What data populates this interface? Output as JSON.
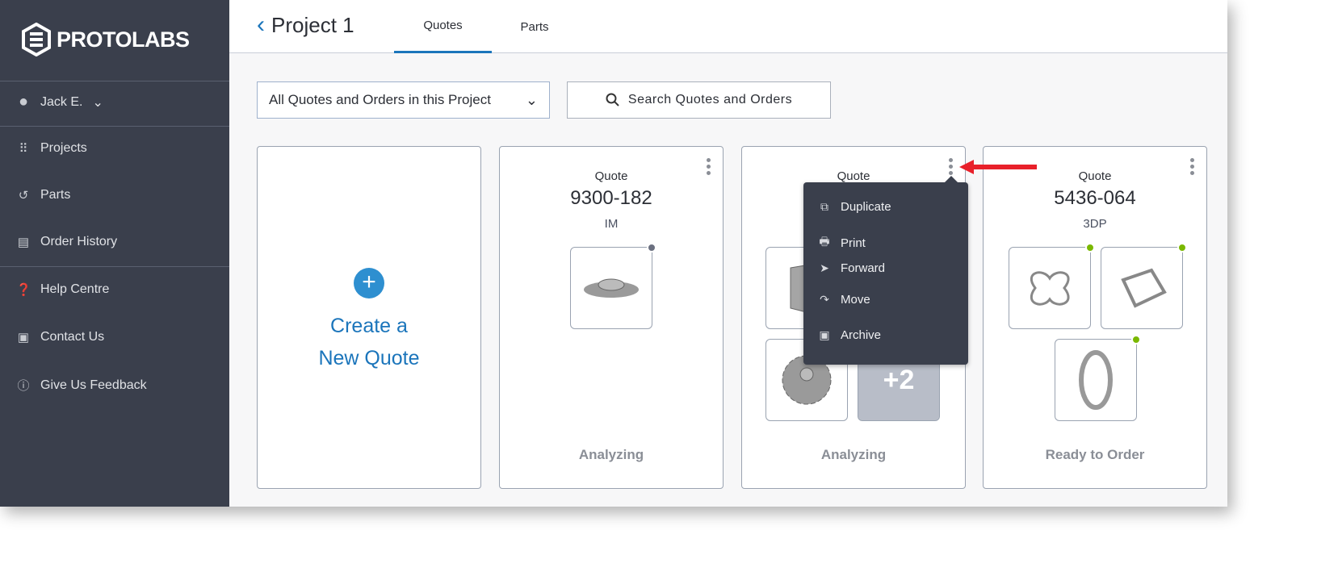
{
  "brand": {
    "name": "PROTOLABS"
  },
  "sidebar": {
    "user": "Jack E.",
    "items": [
      {
        "label": "Projects",
        "icon": "grid-icon"
      },
      {
        "label": "Parts",
        "icon": "undo-icon"
      },
      {
        "label": "Order History",
        "icon": "order-history-icon"
      },
      {
        "label": "Help Centre",
        "icon": "help-icon"
      },
      {
        "label": "Contact Us",
        "icon": "contact-card-icon"
      },
      {
        "label": "Give Us Feedback",
        "icon": "feedback-icon"
      }
    ]
  },
  "header": {
    "title": "Project 1",
    "tabs": [
      {
        "label": "Quotes",
        "active": true
      },
      {
        "label": "Parts",
        "active": false
      }
    ]
  },
  "filter": {
    "selected": "All Quotes and Orders in this Project"
  },
  "search": {
    "label": "Search Quotes and Orders"
  },
  "create": {
    "line1": "Create a",
    "line2": "New Quote"
  },
  "cards": [
    {
      "label": "Quote",
      "number": "9300-182",
      "type": "IM",
      "status": "Analyzing"
    },
    {
      "label": "Quote",
      "number": "",
      "type": "",
      "status": "Analyzing",
      "more": "+2"
    },
    {
      "label": "Quote",
      "number": "5436-064",
      "type": "3DP",
      "status": "Ready to Order"
    }
  ],
  "menu": {
    "items": [
      {
        "label": "Duplicate",
        "icon": "duplicate-icon"
      },
      {
        "label": "Print",
        "icon": "print-icon"
      },
      {
        "label": "Forward",
        "icon": "send-icon"
      },
      {
        "label": "Move",
        "icon": "move-arrow-icon"
      },
      {
        "label": "Archive",
        "icon": "archive-icon"
      }
    ]
  },
  "colors": {
    "sidebar": "#3a3f4c",
    "accent": "#1b75bb",
    "ready_dot": "#7ab800",
    "analyzing_dot": "#6b7080",
    "annotation_arrow": "#e8202a"
  }
}
